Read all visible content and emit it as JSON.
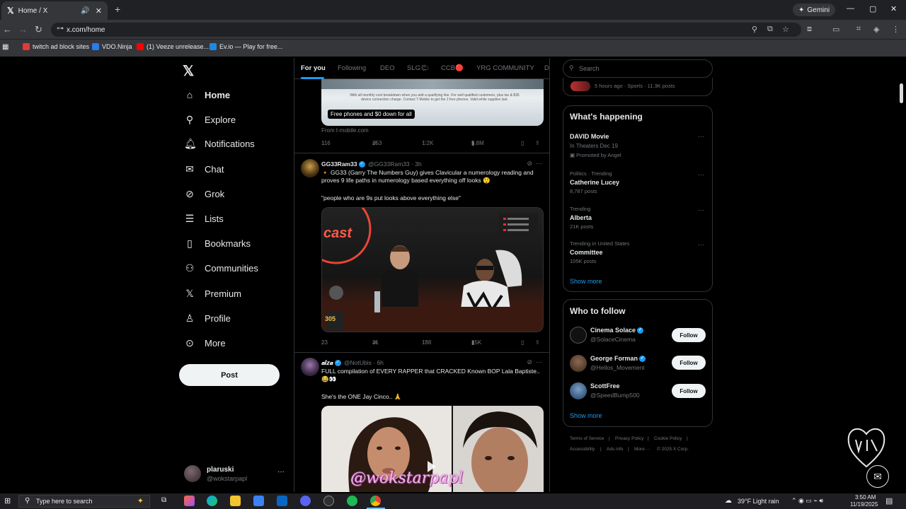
{
  "browser": {
    "tab_title": "Home / X",
    "tab_icon": "x-logo-icon",
    "url": "x.com/home",
    "gemini_label": "Gemini",
    "bookmarks": [
      {
        "label": "twitch ad block sites",
        "color": "#e03a3a"
      },
      {
        "label": "VDO.Ninja",
        "color": "#2b7de9"
      },
      {
        "label": "(1) Veeze unrelease...",
        "color": "#ff0000"
      },
      {
        "label": "Ev.io — Play for free...",
        "color": "#1e88e5"
      }
    ]
  },
  "sidebar": {
    "items": [
      {
        "label": "Home",
        "icon": "home-icon",
        "active": true
      },
      {
        "label": "Explore",
        "icon": "search-icon"
      },
      {
        "label": "Notifications",
        "icon": "bell-icon"
      },
      {
        "label": "Chat",
        "icon": "mail-icon"
      },
      {
        "label": "Grok",
        "icon": "grok-icon"
      },
      {
        "label": "Lists",
        "icon": "list-icon"
      },
      {
        "label": "Bookmarks",
        "icon": "bookmark-icon"
      },
      {
        "label": "Communities",
        "icon": "communities-icon"
      },
      {
        "label": "Premium",
        "icon": "x-premium-icon"
      },
      {
        "label": "Profile",
        "icon": "profile-icon"
      },
      {
        "label": "More",
        "icon": "more-circle-icon"
      }
    ],
    "post_label": "Post",
    "account": {
      "name": "plaruski",
      "handle": "@wokstarpapl"
    }
  },
  "feed": {
    "tabs": [
      "For you",
      "Following",
      "DEO",
      "SLG🌤",
      "CCB🔴",
      "YRG COMMUNITY",
      "D"
    ],
    "ad": {
      "caption": "Free phones and $0 down for all",
      "small_text": "With all monthly cost breakdown when you add a qualifying line. For well qualified customers, plus tax & $35 device connection charge. Contact T-Mobile to get the 2 free phones. Valid while supplies last.",
      "from": "From t-mobile.com",
      "stats": {
        "replies": "116",
        "reposts": "253",
        "likes": "1.2K",
        "views": "5.8M"
      }
    },
    "tweets": [
      {
        "name": "GG33Ram33",
        "handle": "@GG33Ram33",
        "time": "· 3h",
        "text": "🔸 GG33 (Garry The Numbers Guy) gives Clavicular a numerology reading and proves 9 life paths in numerology based everything off looks 😲",
        "text2": "\"people who are 9s put looks above everything else\"",
        "stats": {
          "replies": "23",
          "reposts": "31",
          "likes": "188",
          "views": "15K"
        }
      },
      {
        "name": "𝒂𝒍𝒛𝒂",
        "handle": "@NotUbis",
        "time": "· 6h",
        "text": "FULL compilation of EVERY RAPPER that CRACKED Known BOP Lala Baptiste.. 😂👀",
        "text2": "She's the ONE Jay Cinco.. 🙏"
      }
    ],
    "watermark": "@wokstarpapl"
  },
  "right": {
    "search_placeholder": "Search",
    "top_meta": "5 hours ago · Sports · 11.3K posts",
    "happening": {
      "title": "What's happening",
      "items": [
        {
          "meta": "",
          "name": "DAVID Movie",
          "sub": "In Theaters Dec 19",
          "sub2": "Promoted by Angel"
        },
        {
          "meta": "Politics · Trending",
          "name": "Catherine Lucey",
          "sub": "8,787 posts"
        },
        {
          "meta": "Trending",
          "name": "Alberta",
          "sub": "21K posts"
        },
        {
          "meta": "Trending in United States",
          "name": "Committee",
          "sub": "105K posts"
        }
      ],
      "show_more": "Show more"
    },
    "who_to_follow": {
      "title": "Who to follow",
      "items": [
        {
          "name": "Cinema Solace",
          "handle": "@SolaceCinema"
        },
        {
          "name": "George Forman",
          "handle": "@Hellos_Movement"
        },
        {
          "name": "ScottFree",
          "handle": "@SpeedBump500"
        }
      ],
      "follow_label": "Follow",
      "show_more": "Show more"
    },
    "footer": [
      "Terms of Service",
      "Privacy Policy",
      "Cookie Policy",
      "Accessibility",
      "Ads info",
      "More ···",
      "© 2025 X Corp."
    ]
  },
  "taskbar": {
    "search_placeholder": "Type here to search",
    "weather": "39°F  Light rain",
    "time": "3:50 AM",
    "date": "11/19/2025"
  }
}
